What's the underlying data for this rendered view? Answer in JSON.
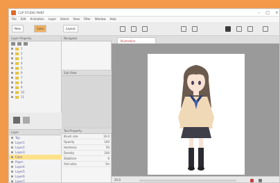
{
  "window": {
    "title": "CLIP STUDIO PAINT"
  },
  "menu": [
    "File",
    "Edit",
    "Animation",
    "Layer",
    "Select",
    "View",
    "Filter",
    "Window",
    "Help"
  ],
  "toolbar": {
    "btn1": "New",
    "btn2": "Color",
    "btn3": "Layout"
  },
  "layers_panel": {
    "header": "Layer Property",
    "items": [
      "1",
      "2",
      "3",
      "4",
      "5",
      "6",
      "7",
      "8",
      "9",
      "10",
      "11"
    ]
  },
  "layers2": {
    "header": "Layer",
    "items": [
      "Top",
      "Layer1",
      "Layer2",
      "Layer3",
      "Color",
      "Paper",
      "Layer4",
      "Layer5",
      "Layer6",
      "Layer7",
      "Layer8",
      "Layer9"
    ]
  },
  "mid": {
    "header1": "Navigator",
    "header2": "Sub View",
    "header3": "Tool Property",
    "rows": [
      {
        "k": "Brush size",
        "v": "10.0"
      },
      {
        "k": "Opacity",
        "v": "100"
      },
      {
        "k": "Hardness",
        "v": "50"
      },
      {
        "k": "Density",
        "v": "100"
      },
      {
        "k": "Stabilizer",
        "v": "6"
      },
      {
        "k": "Anti-alias",
        "v": "On"
      }
    ]
  },
  "canvas": {
    "tab": "Illustration",
    "zoom": "25.0"
  },
  "colors": {
    "accent": "#f39a4a",
    "selected": "#ffe28a",
    "folder": "#e8c23a"
  }
}
